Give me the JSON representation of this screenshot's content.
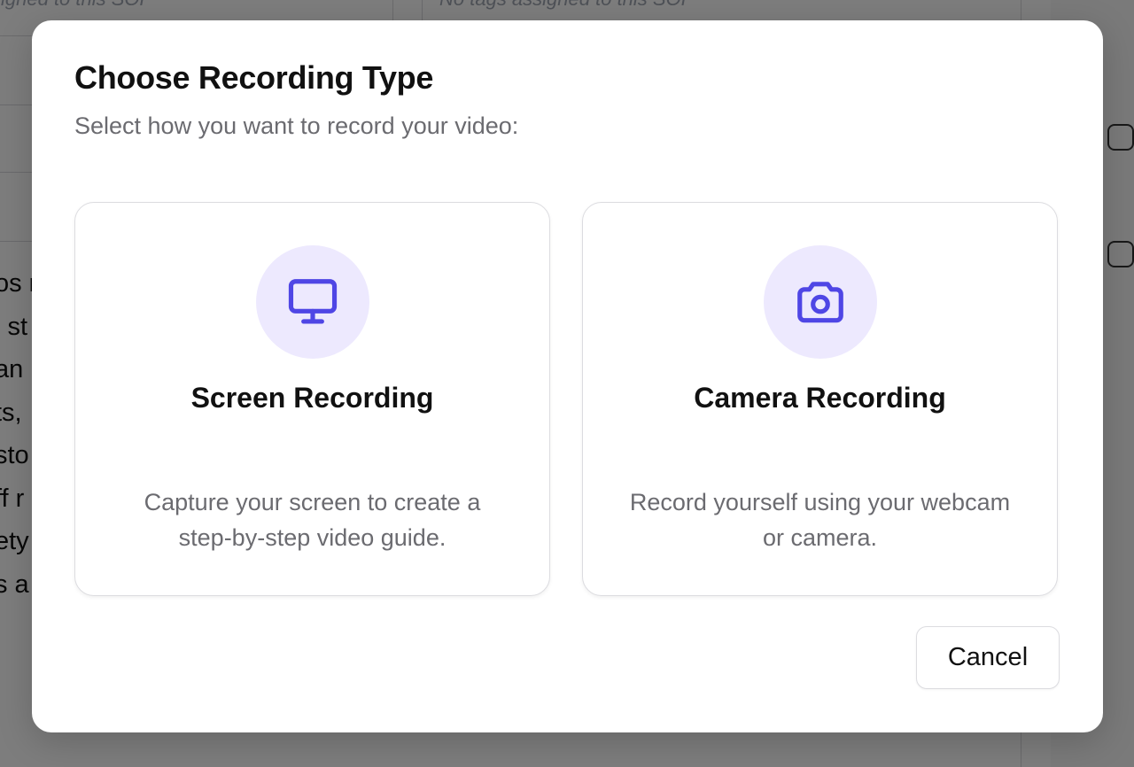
{
  "background": {
    "ghost_left": "signed to this SOP",
    "ghost_right": "No tags assigned to this SOP",
    "body_fragments": [
      "os n",
      "l st",
      "an",
      "ts,",
      "sto",
      "ff r",
      "ety",
      "s a"
    ]
  },
  "modal": {
    "title": "Choose Recording Type",
    "subtitle": "Select how you want to record your video:",
    "options": [
      {
        "title": "Screen Recording",
        "description": "Capture your screen to create a step-by-step video guide.",
        "icon": "monitor-icon"
      },
      {
        "title": "Camera Recording",
        "description": "Record yourself using your webcam or camera.",
        "icon": "camera-icon"
      }
    ],
    "cancel_label": "Cancel"
  },
  "colors": {
    "accent": "#4f46e5",
    "icon_bg": "#ede9fe",
    "overlay": "rgba(0,0,0,0.5)"
  }
}
